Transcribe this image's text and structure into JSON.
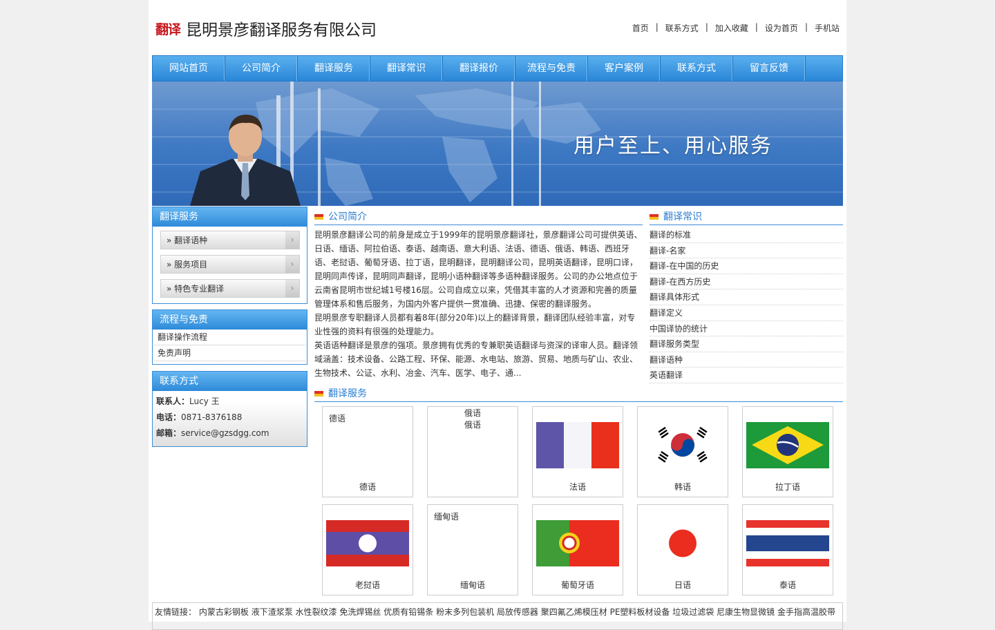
{
  "header": {
    "logo_mark": "翻译",
    "company": "昆明景彦翻译服务有限公司",
    "toplinks": [
      "首页",
      "联系方式",
      "加入收藏",
      "设为首页",
      "手机站"
    ],
    "sep": "|"
  },
  "nav": [
    "网站首页",
    "公司简介",
    "翻译服务",
    "翻译常识",
    "翻译报价",
    "流程与免责",
    "客户案例",
    "联系方式",
    "留言反馈"
  ],
  "banner": {
    "slogan": "用户至上、用心服务"
  },
  "left": {
    "services": {
      "title": "翻译服务",
      "items": [
        "» 翻译语种",
        "» 服务项目",
        "» 特色专业翻译"
      ],
      "arrow": "›"
    },
    "flow": {
      "title": "流程与免责",
      "items": [
        "翻译操作流程",
        "免责声明"
      ]
    },
    "contact": {
      "title": "联系方式",
      "person_label": "联系人：",
      "person": "Lucy 王",
      "phone_label": "电话：",
      "phone": "0871-8376188",
      "email_label": "邮箱：",
      "email": "service@gzsdgg.com"
    }
  },
  "intro": {
    "title": "公司简介",
    "p1": "昆明景彦翻译公司的前身是成立于1999年的昆明景彦翻译社，景彦翻译公司可提供英语、日语、缅语、阿拉伯语、泰语、越南语、意大利语、法语、德语、俄语、韩语、西班牙语、老挝语、葡萄牙语、拉丁语，昆明翻译，昆明翻译公司，昆明英语翻译，昆明口译，昆明同声传译，昆明同声翻译，昆明小语种翻译等多语种翻译服务。公司的办公地点位于云南省昆明市世纪城1号楼16层。公司自成立以来，凭借其丰富的人才资源和完善的质量管理体系和售后服务，为国内外客户提供一贯准确、迅捷、保密的翻译服务。",
    "p2": "昆明景彦专职翻译人员都有着8年(部分20年)以上的翻译背景，翻译团队经验丰富，对专业性强的资料有很强的处理能力。",
    "p3": "英语语种翻译是景彦的强项。景彦拥有优秀的专兼职英语翻译与资深的译审人员。翻译领域涵盖：技术设备、公路工程、环保、能源、水电站、旅游、贸易、地质与矿山、农业、生物技术、公证、水利、冶金、汽车、医学、电子、通..."
  },
  "knowledge": {
    "title": "翻译常识",
    "items": [
      "翻译的标准",
      "翻译-名家",
      "翻译-在中国的历史",
      "翻译-在西方历史",
      "翻译具体形式",
      "翻译定义",
      "中国译协的统计",
      "翻译服务类型",
      "翻译语种",
      "英语翻译"
    ]
  },
  "services_grid": {
    "title": "翻译服务",
    "cards": [
      {
        "caption": "德语",
        "alt": "德语",
        "flag": "none"
      },
      {
        "caption": "",
        "alt": "俄语\n俄语",
        "flag": "none"
      },
      {
        "caption": "法语",
        "alt": "",
        "flag": "france"
      },
      {
        "caption": "韩语",
        "alt": "",
        "flag": "korea"
      },
      {
        "caption": "拉丁语",
        "alt": "",
        "flag": "brazil"
      },
      {
        "caption": "老挝语",
        "alt": "",
        "flag": "laos"
      },
      {
        "caption": "缅甸语",
        "alt": "缅甸语",
        "flag": "none"
      },
      {
        "caption": "葡萄牙语",
        "alt": "",
        "flag": "portugal"
      },
      {
        "caption": "日语",
        "alt": "",
        "flag": "japan"
      },
      {
        "caption": "泰语",
        "alt": "",
        "flag": "thailand"
      }
    ]
  },
  "friend_links": {
    "label": "友情链接：",
    "items": [
      "内蒙古彩钢板",
      "液下渣浆泵",
      "水性裂纹漆",
      "免洗焊锡丝",
      "优质有铅锡条",
      "粉末多列包装机",
      "局放传感器",
      "聚四氟乙烯模压材",
      "PE塑料板材设备",
      "垃圾过滤袋",
      "尼康生物显微镜",
      "金手指高温胶带"
    ]
  },
  "colors": {
    "nav": "#2a86d8",
    "accent": "#3a8bd8",
    "logo": "#c8161d"
  }
}
